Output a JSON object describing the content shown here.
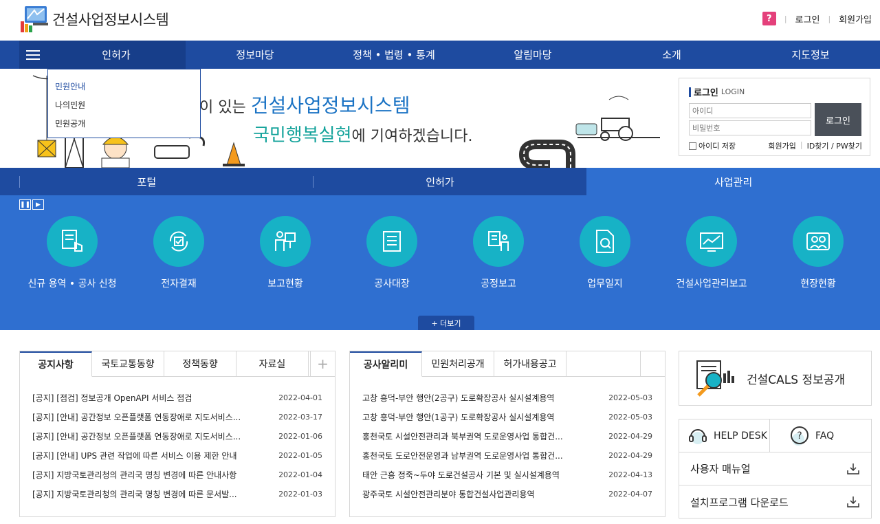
{
  "header": {
    "site_title": "건설사업정보시스템",
    "help_icon_text": "?",
    "login_link": "로그인",
    "signup_link": "회원가입"
  },
  "nav": {
    "items": [
      "인허가",
      "정보마당",
      "정책 • 법령 • 통계",
      "알림마당",
      "소개",
      "지도정보"
    ]
  },
  "dropdown": {
    "items": [
      "민원안내",
      "나의민원",
      "민원공개"
    ]
  },
  "banner": {
    "line1_prefix": "이 있는 ",
    "line1_highlight": "건설사업정보시스템",
    "line2_highlight": "국민행복실현",
    "line2_suffix": "에 기여하겠습니다."
  },
  "login": {
    "title": "로그인",
    "title_en": "LOGIN",
    "id_placeholder": "아이디",
    "pw_placeholder": "비밀번호",
    "button": "로그인",
    "save_id": "아이디 저장",
    "signup": "회원가입",
    "find": "ID찾기 / PW찾기"
  },
  "tabstrip": {
    "tabs": [
      "포털",
      "인허가",
      "사업관리"
    ]
  },
  "services": {
    "items": [
      "신규 용역 • 공사 신청",
      "전자결재",
      "보고현황",
      "공사대장",
      "공정보고",
      "업무일지",
      "건설사업관리보고",
      "현장현황"
    ],
    "more": "+ 더보기"
  },
  "notice_panel": {
    "tabs": [
      "공지사항",
      "국토교통동향",
      "정책동향",
      "자료실"
    ],
    "plus": "+",
    "rows": [
      {
        "title": "[공지] [점검] 정보공개 OpenAPI 서비스 점검",
        "date": "2022-04-01"
      },
      {
        "title": "[공지] [안내] 공간정보 오픈플랫폼 연동장애로 지도서비스...",
        "date": "2022-03-17"
      },
      {
        "title": "[공지] [안내] 공간정보 오픈플랫폼 연동장애로 지도서비스...",
        "date": "2022-01-06"
      },
      {
        "title": "[공지] [안내] UPS 관련 작업에 따른 서비스 이용 제한 안내",
        "date": "2022-01-05"
      },
      {
        "title": "[공지] 지방국토관리청의 관리국 명칭 변경에 따른 안내사항",
        "date": "2022-01-04"
      },
      {
        "title": "[공지] 지방국토관리청의 관리국 명칭 변경에 따른 문서발...",
        "date": "2022-01-03"
      }
    ]
  },
  "work_panel": {
    "tabs": [
      "공사알리미",
      "민원처리공개",
      "허가내용공고"
    ],
    "rows": [
      {
        "title": "고창 흥덕-부안 행안(2공구) 도로확장공사 실시설계용역",
        "date": "2022-05-03"
      },
      {
        "title": "고창 흥덕-부안 행안(1공구) 도로확장공사 실시설계용역",
        "date": "2022-05-03"
      },
      {
        "title": "홍천국토 시설안전관리과 북부권역 도로운영사업 통합건...",
        "date": "2022-04-29"
      },
      {
        "title": "홍천국토 도로안전운영과 남부권역 도로운영사업 통합건...",
        "date": "2022-04-29"
      },
      {
        "title": "태안 근흥 정죽~두야 도로건설공사 기본 및 실시설계용역",
        "date": "2022-04-13"
      },
      {
        "title": "광주국토 시설안전관리분야 통합건설사업관리용역",
        "date": "2022-04-07"
      }
    ]
  },
  "right": {
    "cals": "건설CALS 정보공개",
    "helpdesk": "HELP DESK",
    "faq": "FAQ",
    "manual": "사용자 매뉴얼",
    "installer": "설치프로그램 다운로드"
  },
  "colors": {
    "nav": "#1e4ba0",
    "service_bg": "#2f6fd0",
    "service_circle": "#17b2c6",
    "accent_pink": "#e4407b"
  }
}
